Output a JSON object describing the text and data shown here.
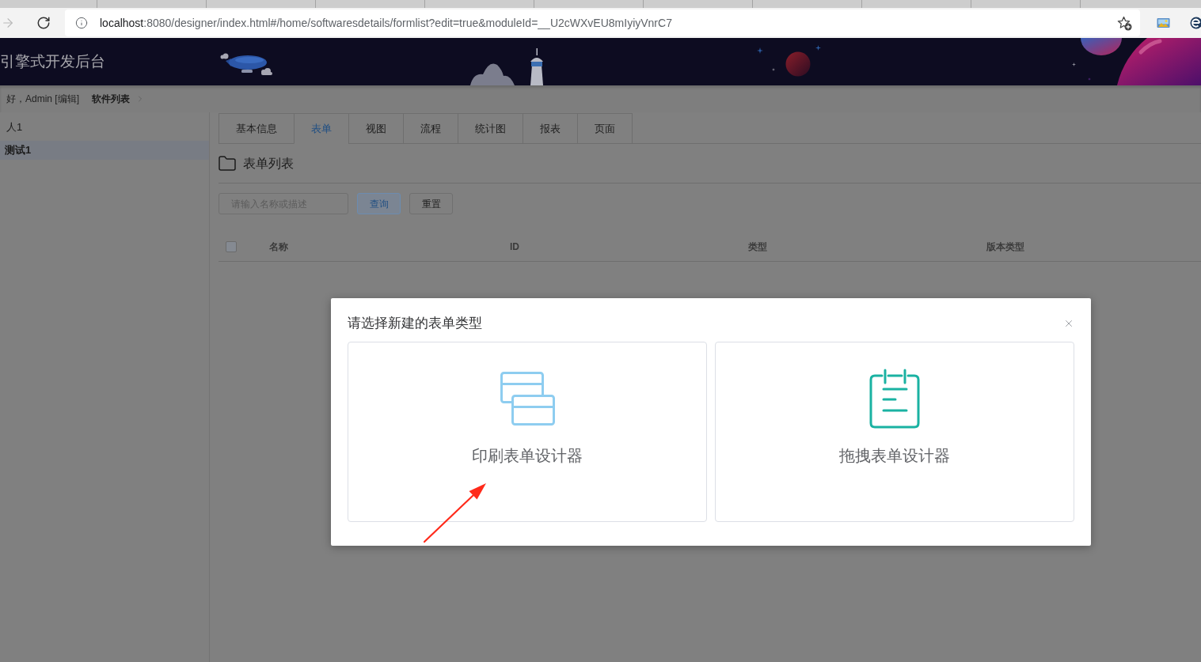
{
  "browser": {
    "address": {
      "host": "localhost",
      "path": ":8080/designer/index.html#/home/softwaresdetails/formlist?edit=true&moduleId=__U2cWXvEU8mIyiyVnrC7"
    }
  },
  "header": {
    "title": "引擎式开发后台"
  },
  "breadcrumb": {
    "greeting": "好，Admin [编辑]",
    "items": [
      {
        "label": "软件列表"
      }
    ]
  },
  "sidebar": {
    "items": [
      {
        "label": "人1",
        "selected": false,
        "children": [
          {
            "label": "测试1",
            "selected": true
          }
        ]
      }
    ]
  },
  "tabs": [
    {
      "label": "基本信息",
      "selected": false
    },
    {
      "label": "表单",
      "selected": true
    },
    {
      "label": "视图",
      "selected": false
    },
    {
      "label": "流程",
      "selected": false
    },
    {
      "label": "统计图",
      "selected": false
    },
    {
      "label": "报表",
      "selected": false
    },
    {
      "label": "页面",
      "selected": false
    }
  ],
  "section": {
    "title": "表单列表"
  },
  "search": {
    "placeholder": "请输入名称或描述",
    "buttons": [
      {
        "label": "查询",
        "kind": "primary"
      },
      {
        "label": "重置",
        "kind": "default"
      }
    ]
  },
  "table": {
    "select_all": {
      "checked": false
    },
    "columns": [
      "名称",
      "ID",
      "类型",
      "版本类型"
    ]
  },
  "dialog": {
    "title": "请选择新建的表单类型",
    "options": [
      {
        "label": "印刷表单设计器",
        "kind": "print"
      },
      {
        "label": "拖拽表单设计器",
        "kind": "drag"
      }
    ]
  }
}
